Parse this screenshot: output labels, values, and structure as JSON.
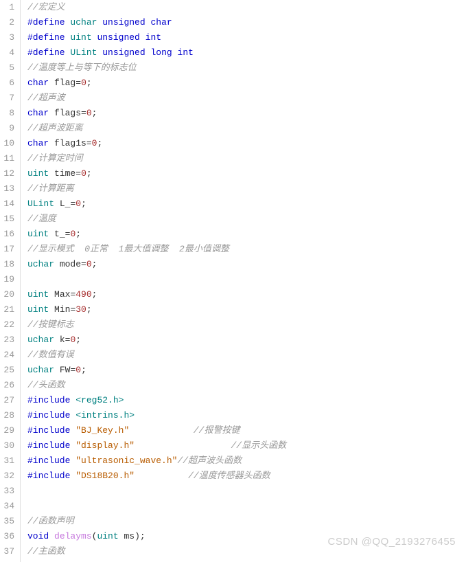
{
  "watermark": "CSDN @QQ_2193276455",
  "lines": [
    [
      {
        "c": "tok-cmt",
        "t": "//宏定义"
      }
    ],
    [
      {
        "c": "tok-pre",
        "t": "#define"
      },
      {
        "c": null,
        "t": " "
      },
      {
        "c": "tok-type",
        "t": "uchar"
      },
      {
        "c": null,
        "t": " "
      },
      {
        "c": "tok-kw",
        "t": "unsigned"
      },
      {
        "c": null,
        "t": " "
      },
      {
        "c": "tok-kw",
        "t": "char"
      }
    ],
    [
      {
        "c": "tok-pre",
        "t": "#define"
      },
      {
        "c": null,
        "t": " "
      },
      {
        "c": "tok-type",
        "t": "uint"
      },
      {
        "c": null,
        "t": " "
      },
      {
        "c": "tok-kw",
        "t": "unsigned"
      },
      {
        "c": null,
        "t": " "
      },
      {
        "c": "tok-kw",
        "t": "int"
      }
    ],
    [
      {
        "c": "tok-pre",
        "t": "#define"
      },
      {
        "c": null,
        "t": " "
      },
      {
        "c": "tok-type",
        "t": "ULint"
      },
      {
        "c": null,
        "t": " "
      },
      {
        "c": "tok-kw",
        "t": "unsigned"
      },
      {
        "c": null,
        "t": " "
      },
      {
        "c": "tok-kw",
        "t": "long"
      },
      {
        "c": null,
        "t": " "
      },
      {
        "c": "tok-kw",
        "t": "int"
      }
    ],
    [
      {
        "c": "tok-cmt",
        "t": "//温度等上与等下的标志位"
      }
    ],
    [
      {
        "c": "tok-kw",
        "t": "char"
      },
      {
        "c": null,
        "t": " "
      },
      {
        "c": "tok-id",
        "t": "flag"
      },
      {
        "c": "tok-pun",
        "t": "="
      },
      {
        "c": "tok-num",
        "t": "0"
      },
      {
        "c": "tok-pun",
        "t": ";"
      }
    ],
    [
      {
        "c": "tok-cmt",
        "t": "//超声波"
      }
    ],
    [
      {
        "c": "tok-kw",
        "t": "char"
      },
      {
        "c": null,
        "t": " "
      },
      {
        "c": "tok-id",
        "t": "flags"
      },
      {
        "c": "tok-pun",
        "t": "="
      },
      {
        "c": "tok-num",
        "t": "0"
      },
      {
        "c": "tok-pun",
        "t": ";"
      }
    ],
    [
      {
        "c": "tok-cmt",
        "t": "//超声波距离"
      }
    ],
    [
      {
        "c": "tok-kw",
        "t": "char"
      },
      {
        "c": null,
        "t": " "
      },
      {
        "c": "tok-id",
        "t": "flag1s"
      },
      {
        "c": "tok-pun",
        "t": "="
      },
      {
        "c": "tok-num",
        "t": "0"
      },
      {
        "c": "tok-pun",
        "t": ";"
      }
    ],
    [
      {
        "c": "tok-cmt",
        "t": "//计算定时间"
      }
    ],
    [
      {
        "c": "tok-type",
        "t": "uint"
      },
      {
        "c": null,
        "t": " "
      },
      {
        "c": "tok-id",
        "t": "time"
      },
      {
        "c": "tok-pun",
        "t": "="
      },
      {
        "c": "tok-num",
        "t": "0"
      },
      {
        "c": "tok-pun",
        "t": ";"
      }
    ],
    [
      {
        "c": "tok-cmt",
        "t": "//计算距离"
      }
    ],
    [
      {
        "c": "tok-type",
        "t": "ULint"
      },
      {
        "c": null,
        "t": " "
      },
      {
        "c": "tok-id",
        "t": "L_"
      },
      {
        "c": "tok-pun",
        "t": "="
      },
      {
        "c": "tok-num",
        "t": "0"
      },
      {
        "c": "tok-pun",
        "t": ";"
      }
    ],
    [
      {
        "c": "tok-cmt",
        "t": "//温度"
      }
    ],
    [
      {
        "c": "tok-type",
        "t": "uint"
      },
      {
        "c": null,
        "t": " "
      },
      {
        "c": "tok-id",
        "t": "t_"
      },
      {
        "c": "tok-pun",
        "t": "="
      },
      {
        "c": "tok-num",
        "t": "0"
      },
      {
        "c": "tok-pun",
        "t": ";"
      }
    ],
    [
      {
        "c": "tok-cmt",
        "t": "//显示模式  0正常  1最大值调整  2最小值调整"
      }
    ],
    [
      {
        "c": "tok-type",
        "t": "uchar"
      },
      {
        "c": null,
        "t": " "
      },
      {
        "c": "tok-id",
        "t": "mode"
      },
      {
        "c": "tok-pun",
        "t": "="
      },
      {
        "c": "tok-num",
        "t": "0"
      },
      {
        "c": "tok-pun",
        "t": ";"
      }
    ],
    [],
    [
      {
        "c": "tok-type",
        "t": "uint"
      },
      {
        "c": null,
        "t": " "
      },
      {
        "c": "tok-id",
        "t": "Max"
      },
      {
        "c": "tok-pun",
        "t": "="
      },
      {
        "c": "tok-num",
        "t": "490"
      },
      {
        "c": "tok-pun",
        "t": ";"
      }
    ],
    [
      {
        "c": "tok-type",
        "t": "uint"
      },
      {
        "c": null,
        "t": " "
      },
      {
        "c": "tok-id",
        "t": "Min"
      },
      {
        "c": "tok-pun",
        "t": "="
      },
      {
        "c": "tok-num",
        "t": "30"
      },
      {
        "c": "tok-pun",
        "t": ";"
      }
    ],
    [
      {
        "c": "tok-cmt",
        "t": "//按键标志"
      }
    ],
    [
      {
        "c": "tok-type",
        "t": "uchar"
      },
      {
        "c": null,
        "t": " "
      },
      {
        "c": "tok-id",
        "t": "k"
      },
      {
        "c": "tok-pun",
        "t": "="
      },
      {
        "c": "tok-num",
        "t": "0"
      },
      {
        "c": "tok-pun",
        "t": ";"
      }
    ],
    [
      {
        "c": "tok-cmt",
        "t": "//数值有误"
      }
    ],
    [
      {
        "c": "tok-type",
        "t": "uchar"
      },
      {
        "c": null,
        "t": " "
      },
      {
        "c": "tok-id",
        "t": "FW"
      },
      {
        "c": "tok-pun",
        "t": "="
      },
      {
        "c": "tok-num",
        "t": "0"
      },
      {
        "c": "tok-pun",
        "t": ";"
      }
    ],
    [
      {
        "c": "tok-cmt",
        "t": "//头函数"
      }
    ],
    [
      {
        "c": "tok-pre",
        "t": "#include"
      },
      {
        "c": null,
        "t": " "
      },
      {
        "c": "tok-hdr",
        "t": "<reg52.h>"
      }
    ],
    [
      {
        "c": "tok-pre",
        "t": "#include"
      },
      {
        "c": null,
        "t": " "
      },
      {
        "c": "tok-hdr",
        "t": "<intrins.h>"
      }
    ],
    [
      {
        "c": "tok-pre",
        "t": "#include"
      },
      {
        "c": null,
        "t": " "
      },
      {
        "c": "tok-str",
        "t": "\"BJ_Key.h\""
      },
      {
        "c": null,
        "t": "            "
      },
      {
        "c": "tok-cmt",
        "t": "//报警按键"
      }
    ],
    [
      {
        "c": "tok-pre",
        "t": "#include"
      },
      {
        "c": null,
        "t": " "
      },
      {
        "c": "tok-str",
        "t": "\"display.h\""
      },
      {
        "c": null,
        "t": "                  "
      },
      {
        "c": "tok-cmt",
        "t": "//显示头函数"
      }
    ],
    [
      {
        "c": "tok-pre",
        "t": "#include"
      },
      {
        "c": null,
        "t": " "
      },
      {
        "c": "tok-str",
        "t": "\"ultrasonic_wave.h\""
      },
      {
        "c": "tok-cmt",
        "t": "//超声波头函数"
      }
    ],
    [
      {
        "c": "tok-pre",
        "t": "#include"
      },
      {
        "c": null,
        "t": " "
      },
      {
        "c": "tok-str",
        "t": "\"DS18B20.h\""
      },
      {
        "c": null,
        "t": "          "
      },
      {
        "c": "tok-cmt",
        "t": "//温度传感器头函数"
      }
    ],
    [],
    [],
    [
      {
        "c": "tok-cmt",
        "t": "//函数声明"
      }
    ],
    [
      {
        "c": "tok-kw",
        "t": "void"
      },
      {
        "c": null,
        "t": " "
      },
      {
        "c": "tok-fn",
        "t": "delayms"
      },
      {
        "c": "tok-pun",
        "t": "("
      },
      {
        "c": "tok-type",
        "t": "uint"
      },
      {
        "c": null,
        "t": " "
      },
      {
        "c": "tok-id",
        "t": "ms"
      },
      {
        "c": "tok-pun",
        "t": ");"
      }
    ],
    [
      {
        "c": "tok-cmt",
        "t": "//主函数"
      }
    ]
  ]
}
